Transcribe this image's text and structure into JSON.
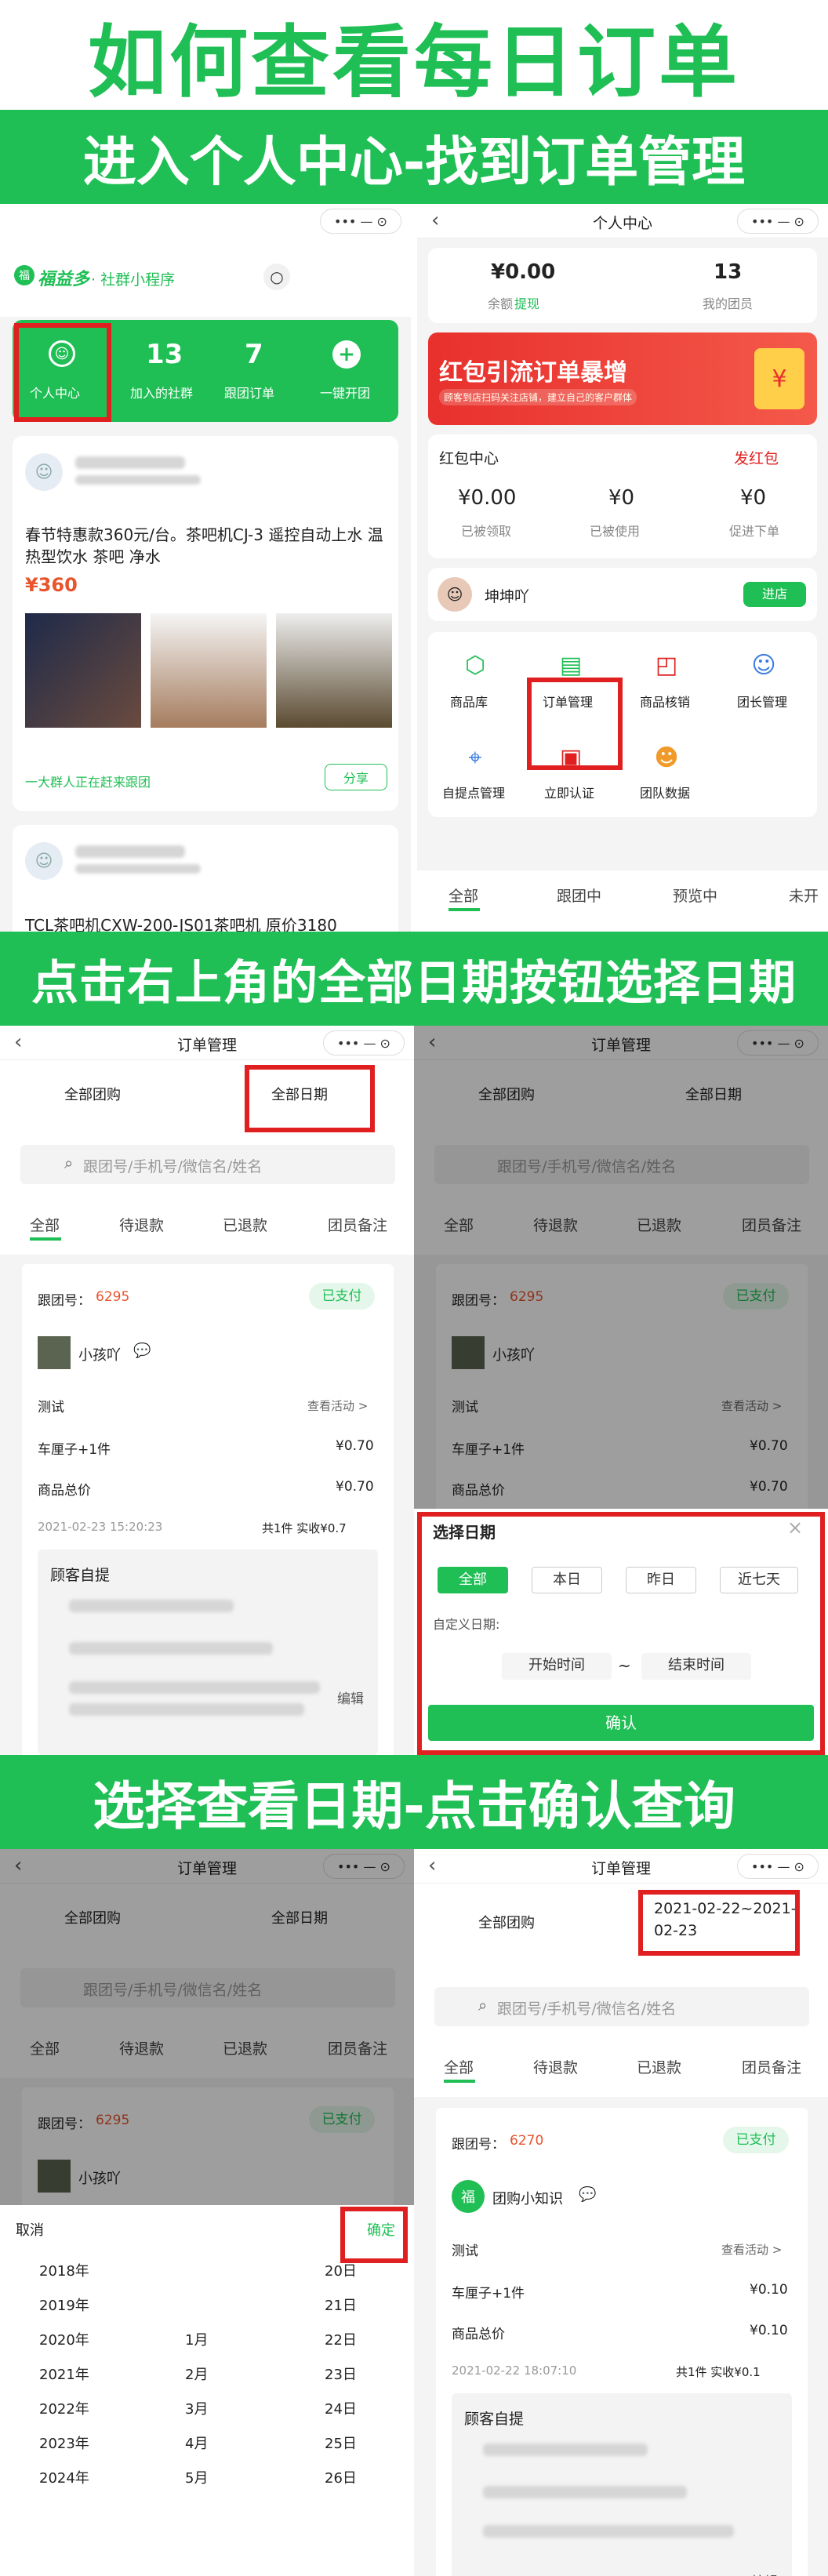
{
  "headline": "如何查看每日订单",
  "bands": [
    "进入个人中心-找到订单管理",
    "点击右上角的全部日期按钮选择日期",
    "选择查看日期-点击确认查询"
  ],
  "nav": {
    "capsule": "•••  —  ⊙",
    "back": "‹"
  },
  "home": {
    "brand": "福益多",
    "brand_sub": "· 社群小程序",
    "menu_label": "个人中心",
    "stats": [
      {
        "v": "13",
        "l": "加入的社群"
      },
      {
        "v": "7",
        "l": "跟团订单"
      },
      {
        "v": "+",
        "l": "一键开团"
      }
    ],
    "post_title": "春节特惠款360元/台。茶吧机CJ-3 遥控自动上水 温热型饮水 茶吧 净水",
    "price": "¥360",
    "crowd": "一大群人正在赶来跟团",
    "share": "分享",
    "post2": "TCL茶吧机CXW-200-JS01茶吧机 原价3180"
  },
  "center": {
    "title": "个人中心",
    "balance": "¥0.00",
    "balance_label": "余额",
    "withdraw": "提现",
    "members": "13",
    "members_label": "我的团员",
    "banner": "红包引流订单暴增",
    "banner_sub": "顾客到店扫码关注店铺，建立自己的客户群体",
    "hb_title": "红包中心",
    "hb_send": "发红包",
    "hb_stats": [
      {
        "v": "¥0.00",
        "l": "已被领取"
      },
      {
        "v": "¥0",
        "l": "已被使用"
      },
      {
        "v": "¥0",
        "l": "促进下单"
      }
    ],
    "user": "坤坤吖",
    "enter_store": "进店",
    "grid": [
      "商品库",
      "订单管理",
      "商品核销",
      "团长管理",
      "自提点管理",
      "立即认证",
      "团队数据"
    ],
    "tabs": [
      "全部",
      "跟团中",
      "预览中",
      "未开"
    ]
  },
  "orders": {
    "title": "订单管理",
    "filter_group": "全部团购",
    "filter_date": "全部日期",
    "search": "跟团号/手机号/微信名/姓名",
    "tabs": [
      "全部",
      "待退款",
      "已退款",
      "团员备注"
    ],
    "order_no_label": "跟团号：",
    "order_no": "6295",
    "paid": "已支付",
    "user": "小孩吖",
    "test": "测试",
    "view": "查看活动 >",
    "item": "车厘子+1件",
    "item_price": "¥0.70",
    "total_label": "商品总价",
    "total": "¥0.70",
    "time": "2021-02-23 15:20:23",
    "summary": "共1件  实收¥0.7",
    "pickup": "顾客自提",
    "edit": "编辑"
  },
  "date_popup": {
    "title": "选择日期",
    "options": [
      "全部",
      "本日",
      "昨日",
      "近七天"
    ],
    "custom": "自定义日期:",
    "start": "开始时间",
    "tilde": "~",
    "end": "结束时间",
    "confirm": "确认"
  },
  "picker": {
    "cancel": "取消",
    "ok": "确定",
    "years": [
      "2018年",
      "2019年",
      "2020年",
      "2021年",
      "2022年",
      "2023年",
      "2024年"
    ],
    "months": [
      "",
      "",
      "1月",
      "2月",
      "3月",
      "4月",
      "5月"
    ],
    "days": [
      "20日",
      "21日",
      "22日",
      "23日",
      "24日",
      "25日",
      "26日"
    ]
  },
  "result": {
    "range": "2021-02-22~2021-02-23",
    "order_no": "6270",
    "user": "团购小知识",
    "item_price": "¥0.10",
    "total": "¥0.10",
    "time": "2021-02-22 18:07:10",
    "summary": "共1件  实收¥0.1"
  },
  "colors": {
    "accent": "#1fbf55",
    "highlight": "#e02020",
    "price": "#e8542c"
  }
}
